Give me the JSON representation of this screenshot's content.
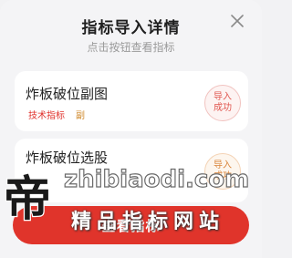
{
  "header": {
    "title": "指标导入详情",
    "subtitle": "点击按钮查看指标"
  },
  "cards": [
    {
      "name": "炸板破位副图",
      "tags": [
        "技术指标",
        "副"
      ],
      "status": "导入成功"
    },
    {
      "name": "炸板破位选股",
      "tags": [],
      "status": "导入成功"
    }
  ],
  "button": {
    "label": "查看指标"
  },
  "watermark": {
    "logo": "帝",
    "site": "zhibiaodi.com",
    "tagline": "精品指标网站"
  },
  "colors": {
    "accent": "#e0342b",
    "secondary_tag": "#d08a2d"
  }
}
